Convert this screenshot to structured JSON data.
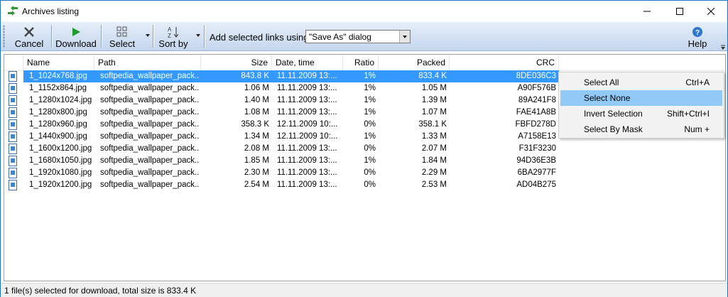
{
  "window": {
    "title": "Archives listing",
    "controls": [
      "minimize",
      "maximize",
      "close"
    ]
  },
  "toolbar": {
    "cancel_label": "Cancel",
    "download_label": "Download",
    "select_label": "Select",
    "sortby_label": "Sort by",
    "add_links_label": "Add selected links using",
    "add_links_value": "\"Save As\" dialog",
    "help_label": "Help"
  },
  "columns": [
    "Name",
    "Path",
    "Size",
    "Date, time",
    "Ratio",
    "Packed",
    "CRC"
  ],
  "rows": [
    {
      "name": "1_1024x768.jpg",
      "path": "softpedia_wallpaper_pack...",
      "size": "843.8 K",
      "date": "11.11.2009 13:...",
      "ratio": "1%",
      "packed": "833.4 K",
      "crc": "8DE036C3",
      "selected": true
    },
    {
      "name": "1_1152x864.jpg",
      "path": "softpedia_wallpaper_pack...",
      "size": "1.06 M",
      "date": "11.11.2009 13:...",
      "ratio": "1%",
      "packed": "1.05 M",
      "crc": "A90F576B",
      "selected": false
    },
    {
      "name": "1_1280x1024.jpg",
      "path": "softpedia_wallpaper_pack...",
      "size": "1.40 M",
      "date": "11.11.2009 13:...",
      "ratio": "1%",
      "packed": "1.39 M",
      "crc": "89A241F8",
      "selected": false
    },
    {
      "name": "1_1280x800.jpg",
      "path": "softpedia_wallpaper_pack...",
      "size": "1.08 M",
      "date": "11.11.2009 13:...",
      "ratio": "1%",
      "packed": "1.07 M",
      "crc": "FAE41A8B",
      "selected": false
    },
    {
      "name": "1_1280x960.jpg",
      "path": "softpedia_wallpaper_pack...",
      "size": "358.3 K",
      "date": "12.11.2009 10:...",
      "ratio": "0%",
      "packed": "358.1 K",
      "crc": "FBFD278D",
      "selected": false
    },
    {
      "name": "1_1440x900.jpg",
      "path": "softpedia_wallpaper_pack...",
      "size": "1.34 M",
      "date": "12.11.2009 10:...",
      "ratio": "1%",
      "packed": "1.33 M",
      "crc": "A7158E13",
      "selected": false
    },
    {
      "name": "1_1600x1200.jpg",
      "path": "softpedia_wallpaper_pack...",
      "size": "2.08 M",
      "date": "11.11.2009 13:...",
      "ratio": "0%",
      "packed": "2.07 M",
      "crc": "F31F3230",
      "selected": false
    },
    {
      "name": "1_1680x1050.jpg",
      "path": "softpedia_wallpaper_pack...",
      "size": "1.85 M",
      "date": "11.11.2009 13:...",
      "ratio": "1%",
      "packed": "1.84 M",
      "crc": "94D36E3B",
      "selected": false
    },
    {
      "name": "1_1920x1080.jpg",
      "path": "softpedia_wallpaper_pack...",
      "size": "2.30 M",
      "date": "11.11.2009 13:...",
      "ratio": "0%",
      "packed": "2.29 M",
      "crc": "6BA2977F",
      "selected": false
    },
    {
      "name": "1_1920x1200.jpg",
      "path": "softpedia_wallpaper_pack...",
      "size": "2.54 M",
      "date": "11.11.2009 13:...",
      "ratio": "0%",
      "packed": "2.53 M",
      "crc": "AD04B275",
      "selected": false
    }
  ],
  "context_menu": [
    {
      "label": "Select All",
      "shortcut": "Ctrl+A",
      "highlighted": false
    },
    {
      "label": "Select None",
      "shortcut": "",
      "highlighted": true
    },
    {
      "label": "Invert Selection",
      "shortcut": "Shift+Ctrl+I",
      "highlighted": false
    },
    {
      "label": "Select By Mask",
      "shortcut": "Num +",
      "highlighted": false
    }
  ],
  "status": "1 file(s) selected for download, total size is 833.4 K",
  "colors": {
    "selection": "#3399ff",
    "menu_highlight": "#91c9f7",
    "toolbar_top": "#e6eef9",
    "toolbar_bottom": "#c4d6ee"
  }
}
